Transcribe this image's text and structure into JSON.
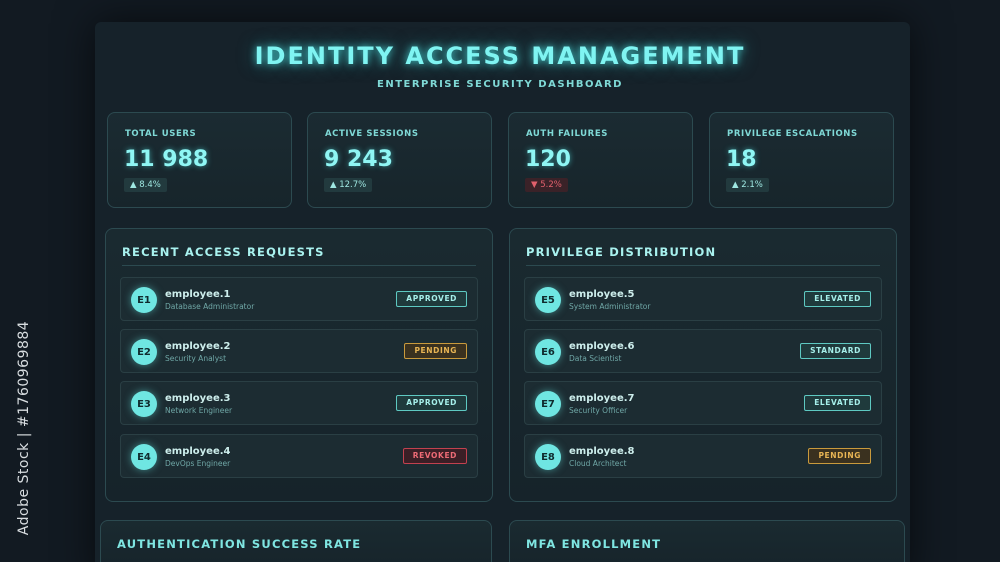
{
  "header": {
    "title": "IDENTITY ACCESS MANAGEMENT",
    "subtitle": "ENTERPRISE SECURITY DASHBOARD"
  },
  "stats": [
    {
      "label": "TOTAL USERS",
      "value": "11 988",
      "delta": "▲ 8.4%",
      "trend": "up"
    },
    {
      "label": "ACTIVE SESSIONS",
      "value": "9 243",
      "delta": "▲ 12.7%",
      "trend": "up"
    },
    {
      "label": "AUTH FAILURES",
      "value": "120",
      "delta": "▼ 5.2%",
      "trend": "down"
    },
    {
      "label": "PRIVILEGE ESCALATIONS",
      "value": "18",
      "delta": "▲ 2.1%",
      "trend": "up"
    }
  ],
  "requests": {
    "title": "RECENT ACCESS REQUESTS",
    "rows": [
      {
        "avatar": "E1",
        "name": "employee.1",
        "role": "Database Administrator",
        "status": "APPROVED"
      },
      {
        "avatar": "E2",
        "name": "employee.2",
        "role": "Security Analyst",
        "status": "PENDING"
      },
      {
        "avatar": "E3",
        "name": "employee.3",
        "role": "Network Engineer",
        "status": "APPROVED"
      },
      {
        "avatar": "E4",
        "name": "employee.4",
        "role": "DevOps Engineer",
        "status": "REVOKED"
      }
    ]
  },
  "privileges": {
    "title": "PRIVILEGE DISTRIBUTION",
    "rows": [
      {
        "avatar": "E5",
        "name": "employee.5",
        "role": "System Administrator",
        "status": "ELEVATED"
      },
      {
        "avatar": "E6",
        "name": "employee.6",
        "role": "Data Scientist",
        "status": "STANDARD"
      },
      {
        "avatar": "E7",
        "name": "employee.7",
        "role": "Security Officer",
        "status": "ELEVATED"
      },
      {
        "avatar": "E8",
        "name": "employee.8",
        "role": "Cloud Architect",
        "status": "PENDING"
      }
    ]
  },
  "bottom": {
    "auth_title": "AUTHENTICATION SUCCESS RATE",
    "mfa_title": "MFA ENROLLMENT"
  },
  "watermark": "Adobe Stock | #1760969884",
  "colors": {
    "accent": "#7ff4f2",
    "approved": "#5ec9c2",
    "pending": "#e8b554",
    "revoked": "#ee6b76",
    "background": "#121a22"
  }
}
